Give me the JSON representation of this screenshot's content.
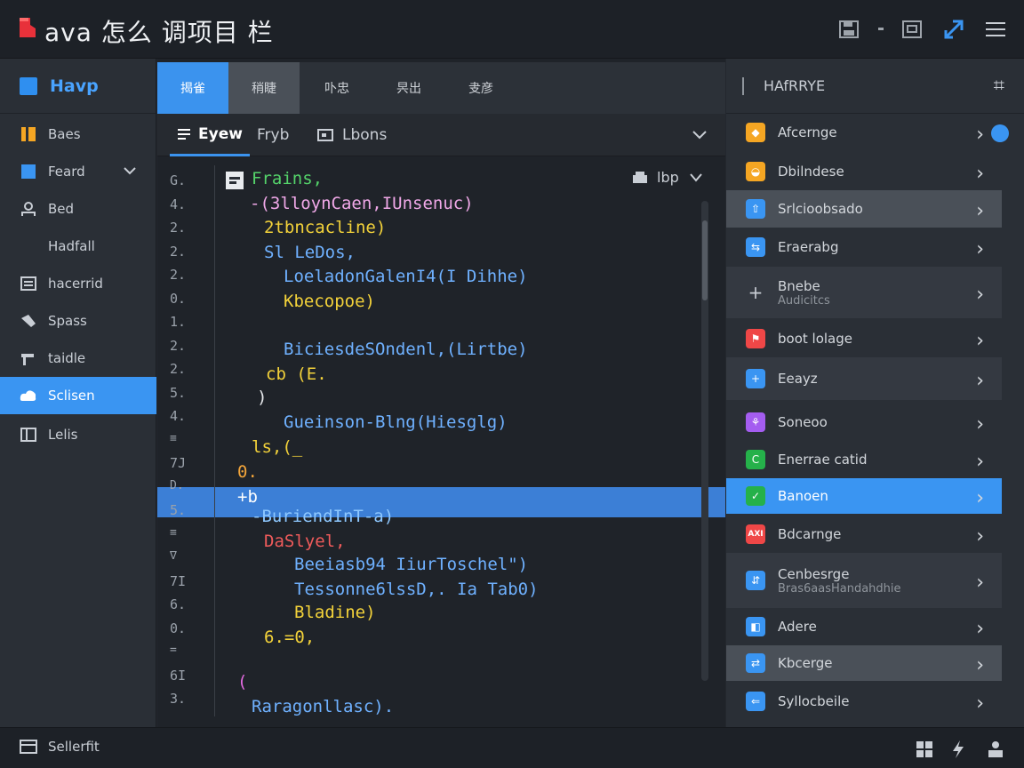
{
  "window": {
    "title": "ava 怎么 调项目 栏"
  },
  "sidebar": {
    "header": "Havp",
    "items": [
      {
        "label": "Baes",
        "icon": "folder-icon"
      },
      {
        "label": "Feard",
        "icon": "square-icon"
      },
      {
        "label": "Bed",
        "icon": "user-icon"
      },
      {
        "label": "Hadfall",
        "icon": "blank-icon"
      },
      {
        "label": "hacerrid",
        "icon": "list-icon"
      },
      {
        "label": "Spass",
        "icon": "brush-icon"
      },
      {
        "label": "taidle",
        "icon": "hammer-icon"
      },
      {
        "label": "Sclisen",
        "icon": "cloud-icon"
      },
      {
        "label": "Lelis",
        "icon": "layout-icon"
      }
    ]
  },
  "editor": {
    "tabs": [
      "揭雀",
      "稍睫",
      "卟忠",
      "昗出",
      "叏彦"
    ],
    "subtabs": [
      "Eyew",
      "Fryb",
      "Lbons"
    ],
    "menu_label": "lbp",
    "line_numbers": [
      "G.",
      "4.",
      "2.",
      "2.",
      "2.",
      "0.",
      "1.",
      "2.",
      "2.",
      "5.",
      "4.",
      "≡",
      "7J",
      "D.",
      "5.",
      "≡",
      "∇",
      "7I",
      "6.",
      "0.",
      "=",
      "6I",
      "3."
    ],
    "lines": [
      {
        "text": "Frains,",
        "color": "#54d36a"
      },
      {
        "text": "-(3lloynCaen,IUnsenuc)",
        "color": "#f0a8e8"
      },
      {
        "text": "2tbncacline)",
        "color": "#f3d23a"
      },
      {
        "text": "Sl LeDos,",
        "color": "#6fb1ff"
      },
      {
        "text": "LoeladonGalenI4(I Dihhe)",
        "color": "#6fb1ff"
      },
      {
        "text": "Kbecopoe)",
        "color": "#f3d23a"
      },
      {
        "text": "BiciesdeSOndenl,(Lirtbe)",
        "color": "#6fb1ff"
      },
      {
        "text": "cb (E.",
        "color": "#f3d23a"
      },
      {
        "text": ")",
        "color": "#e6e8eb"
      },
      {
        "text": "Gueinson-Blng(Hiesglg)",
        "color": "#6fb1ff"
      },
      {
        "text": "ls,(_",
        "color": "#f3d23a"
      },
      {
        "text": "0.",
        "color": "#f3a53a"
      },
      {
        "text": "+b",
        "color": "#ffffff"
      },
      {
        "text": "-BuriendInT-a)",
        "color": "#8ec8ff"
      },
      {
        "text": "DaSlyel,",
        "color": "#ef5b5b"
      },
      {
        "text": "Beeiasb94 IiurToschel\")",
        "color": "#6fb1ff"
      },
      {
        "text": "Tessonne6lssD,. Ia Tab0)",
        "color": "#6fb1ff"
      },
      {
        "text": "Bladine)",
        "color": "#f3d23a"
      },
      {
        "text": "6.=0,",
        "color": "#f3d23a"
      },
      {
        "text": "(",
        "color": "#e36be0"
      },
      {
        "text": "Raragonllasc).",
        "color": "#6fb1ff"
      }
    ]
  },
  "right_panel": {
    "header": "HAfRRYE",
    "items": [
      {
        "label": "Afcernge",
        "icon_color": "#f5a623"
      },
      {
        "label": "Dbilndese",
        "icon_color": "#f5a623"
      },
      {
        "label": "Srlcioobsado",
        "icon_color": "#3a95f2"
      },
      {
        "label": "Eraerabg",
        "icon_color": "#3a95f2"
      },
      {
        "label": "Bnebe",
        "sublabel": "Audicitcs",
        "icon_color": "none"
      },
      {
        "label": "boot lolage",
        "icon_color": "#ef4747"
      },
      {
        "label": "Eeayz",
        "icon_color": "#3a95f2"
      },
      {
        "label": "Soneoo",
        "icon_color": "#a45df0"
      },
      {
        "label": "Enerrae catid",
        "icon_color": "#25b14a"
      },
      {
        "label": "Banoen",
        "icon_color": "#25b14a"
      },
      {
        "label": "Bdcarnge",
        "icon_color": "#ef4747",
        "icon_text": "AXI"
      },
      {
        "label": "Cenbesrge",
        "sublabel": "Bras6aasHandahdhie",
        "icon_color": "#3a95f2"
      },
      {
        "label": "Adere",
        "icon_color": "#3a95f2"
      },
      {
        "label": "Kbcerge",
        "icon_color": "#3a95f2"
      },
      {
        "label": "Syllocbeile",
        "icon_color": "#3a95f2"
      }
    ]
  },
  "statusbar": {
    "label": "Sellerfit"
  },
  "colors": {
    "accent": "#3a95f2",
    "background": "#23272e"
  }
}
